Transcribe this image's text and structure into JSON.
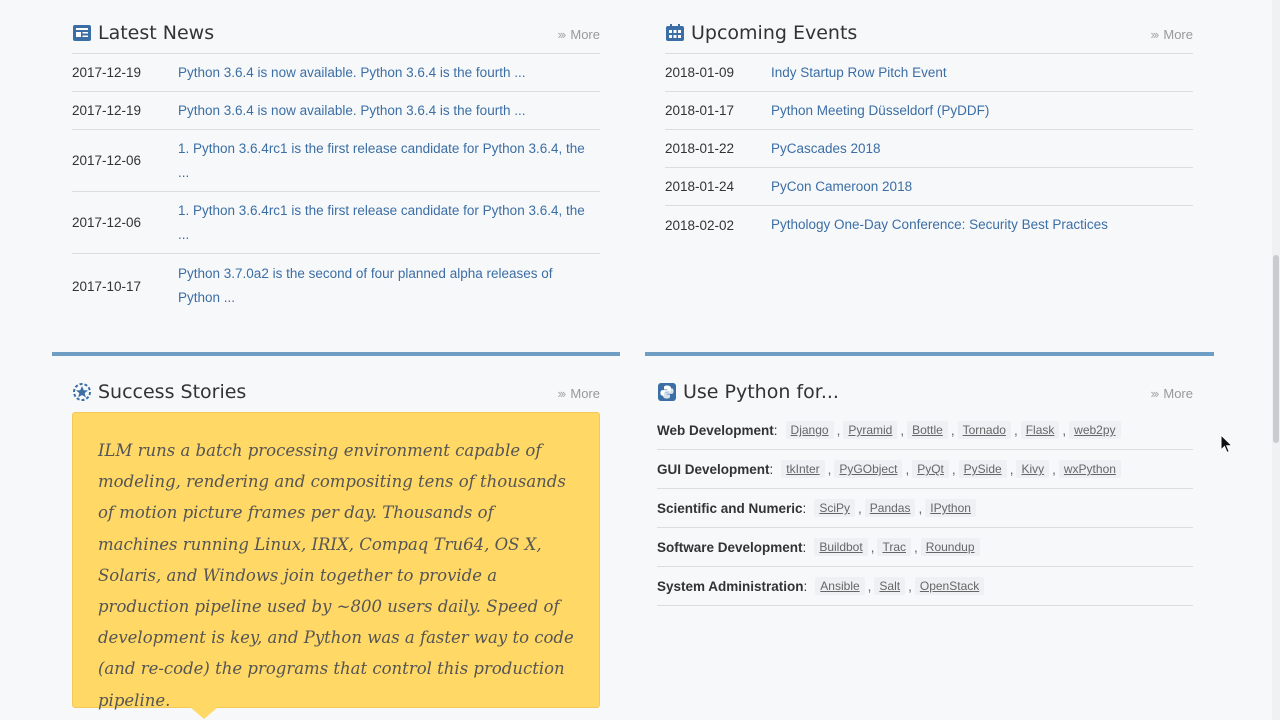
{
  "more_label": "More",
  "news": {
    "title": "Latest News",
    "items": [
      {
        "date": "2017-12-19",
        "text": "Python 3.6.4 is now available.  Python 3.6.4 is the fourth ..."
      },
      {
        "date": "2017-12-19",
        "text": "Python 3.6.4 is now available.  Python 3.6.4 is the fourth ..."
      },
      {
        "date": "2017-12-06",
        "text": "1. Python 3.6.4rc1 is the first release candidate for Python 3.6.4, the ..."
      },
      {
        "date": "2017-12-06",
        "text": "1. Python 3.6.4rc1 is the first release candidate for Python 3.6.4, the ..."
      },
      {
        "date": "2017-10-17",
        "text": "Python 3.7.0a2 is the second of four planned alpha releases of Python ..."
      }
    ]
  },
  "events": {
    "title": "Upcoming Events",
    "items": [
      {
        "date": "2018-01-09",
        "text": "Indy Startup Row Pitch Event"
      },
      {
        "date": "2018-01-17",
        "text": "Python Meeting Düsseldorf (PyDDF)"
      },
      {
        "date": "2018-01-22",
        "text": "PyCascades 2018"
      },
      {
        "date": "2018-01-24",
        "text": "PyCon Cameroon 2018"
      },
      {
        "date": "2018-02-02",
        "text": "Pythology One-Day Conference: Security Best Practices"
      }
    ]
  },
  "success": {
    "title": "Success Stories",
    "quote": "ILM runs a batch processing environment capable of modeling, rendering and compositing tens of thousands of motion picture frames per day. Thousands of machines running Linux, IRIX, Compaq Tru64, OS X, Solaris, and Windows join together to provide a production pipeline used by ~800 users daily. Speed of development is key, and Python was a faster way to code (and re-code) the programs that control this production pipeline."
  },
  "use_python": {
    "title": "Use Python for...",
    "rows": [
      {
        "category": "Web Development",
        "tags": [
          "Django",
          "Pyramid",
          "Bottle",
          "Tornado",
          "Flask",
          "web2py"
        ]
      },
      {
        "category": "GUI Development",
        "tags": [
          "tkInter",
          "PyGObject",
          "PyQt",
          "PySide",
          "Kivy",
          "wxPython"
        ]
      },
      {
        "category": "Scientific and Numeric",
        "tags": [
          "SciPy",
          "Pandas",
          "IPython"
        ]
      },
      {
        "category": "Software Development",
        "tags": [
          "Buildbot",
          "Trac",
          "Roundup"
        ]
      },
      {
        "category": "System Administration",
        "tags": [
          "Ansible",
          "Salt",
          "OpenStack"
        ]
      }
    ]
  },
  "colors": {
    "link": "#3b6ea5",
    "accent_bar": "#6f9ec4",
    "story_bg": "#ffd866",
    "tag_bg": "#eef0f3"
  }
}
